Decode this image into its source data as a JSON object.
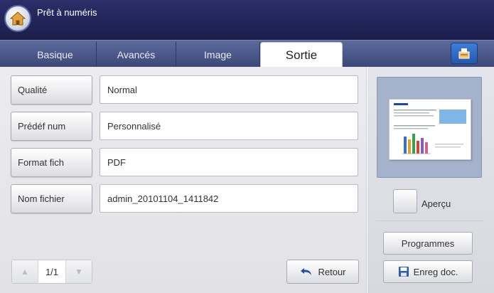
{
  "header": {
    "title": "Prêt à numéris",
    "home_icon": "home-icon"
  },
  "tabs": [
    {
      "label": "Basique",
      "active": false
    },
    {
      "label": "Avancés",
      "active": false
    },
    {
      "label": "Image",
      "active": false
    },
    {
      "label": "Sortie",
      "active": true
    }
  ],
  "tab_icon": "job-status-icon",
  "settings": [
    {
      "label": "Qualité",
      "value": "Normal"
    },
    {
      "label": "Prédéf num",
      "value": "Personnalisé"
    },
    {
      "label": "Format fich",
      "value": "PDF"
    },
    {
      "label": "Nom fichier",
      "value": "admin_20101104_1411842"
    }
  ],
  "pager": {
    "text": "1/1"
  },
  "retour_label": "Retour",
  "side": {
    "apercu_label": "Aperçu",
    "programmes_label": "Programmes",
    "enreg_label": "Enreg doc."
  },
  "colors": {
    "header_bg": "#1f2356",
    "tab_bg": "#4a5788",
    "accent": "#2f6ac4"
  }
}
